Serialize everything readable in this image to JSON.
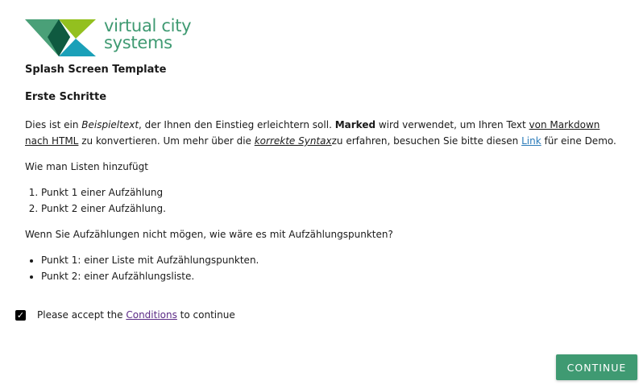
{
  "brand": {
    "line1": "virtual city",
    "line2": "systems",
    "color": "#3f9a72"
  },
  "page_title": "Splash Screen Template",
  "section_heading": "Erste Schritte",
  "intro": {
    "t1": "Dies ist ein ",
    "em1": "Beispieltext",
    "t2": ", der Ihnen den Einstieg erleichtern soll. ",
    "strong1": "Marked",
    "t3": " wird verwendet, um Ihren Text ",
    "link_markdown": "von Markdown nach HTML",
    "t4": " zu konvertieren. Um mehr über die ",
    "syntax": "korrekte Syntax",
    "t5": "zu erfahren, besuchen Sie bitte diesen ",
    "link_demo": "Link",
    "t6": " für eine Demo."
  },
  "lists_heading": "Wie man Listen hinzufügt",
  "ordered_list": [
    "Punkt 1 einer Aufzählung",
    "Punkt 2 einer Aufzählung."
  ],
  "bullets_heading": "Wenn Sie Aufzählungen nicht mögen, wie wäre es mit Aufzählungspunkten?",
  "bullet_list": [
    "Punkt 1: einer Liste mit Aufzählungspunkten.",
    "Punkt 2: einer Aufzählungsliste."
  ],
  "accept": {
    "checked": true,
    "prefix": "Please accept the ",
    "link": "Conditions",
    "suffix": " to continue"
  },
  "continue_label": "CONTINUE",
  "colors": {
    "accent": "#3f9a72",
    "link": "#2b7bb9",
    "conditions_link": "#5b2a86"
  }
}
